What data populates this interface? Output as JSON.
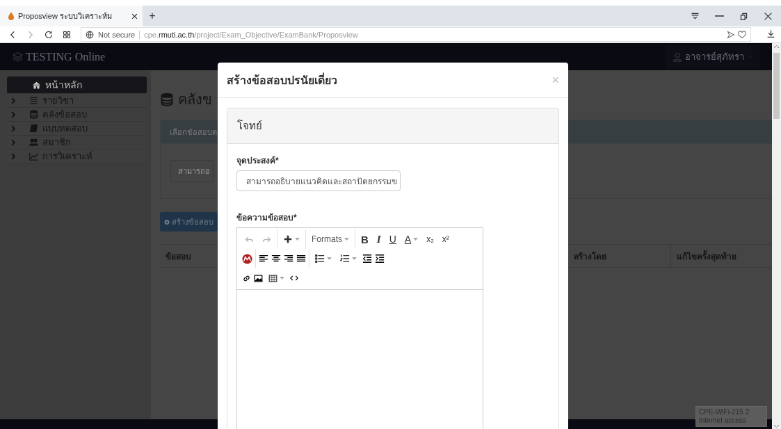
{
  "browser": {
    "tab_title": "Proposview ระบบวิเคราะห์ม",
    "new_tab": "+",
    "security": "Not secure",
    "url_prefix": "cpe.",
    "url_domain": "rmuti.ac.th",
    "url_path": "/project/Exam_Objective/ExamBank/Proposview"
  },
  "navbar": {
    "brand": "TESTING Online",
    "user": "อาจารย์สุภัทรา"
  },
  "sidebar": {
    "items": [
      {
        "label": "หน้าหลัก",
        "selected": true
      },
      {
        "label": "รายวิชา",
        "selected": false
      },
      {
        "label": "คลังข้อสอบ",
        "selected": false
      },
      {
        "label": "แบบทดสอบ",
        "selected": false
      },
      {
        "label": "สมาชิก",
        "selected": false
      },
      {
        "label": "การวิเคราะห์",
        "selected": false
      }
    ]
  },
  "page": {
    "heading": "คลังข",
    "panel_title": "เลือกข้อสอบต",
    "objective_select": "สามารถอ",
    "create_button": "สร้างข้อสอบ",
    "table_columns": [
      "ข้อสอบ",
      "สร้างโดย",
      "แก้ไขครั้งสุดท้าย"
    ]
  },
  "modal": {
    "title": "สร้างข้อสอบปรนัยเดี่ยว",
    "close": "×",
    "panel_title": "โจทย์",
    "objective_label": "จุดประสงค์*",
    "objective_value": "สามารถอธิบายแนวคิดและสถาปัตยกรรมข",
    "question_label": "ข้อความข้อสอบ*",
    "editor": {
      "history_disabled": true,
      "formats": "Formats",
      "bold": "B",
      "italic": "I",
      "underline": "U",
      "text_color": "A",
      "subscript": "x₂",
      "superscript": "x²"
    }
  },
  "network_tooltip": {
    "name": "CPE-WiFi-215 2",
    "status": "Internet access"
  }
}
